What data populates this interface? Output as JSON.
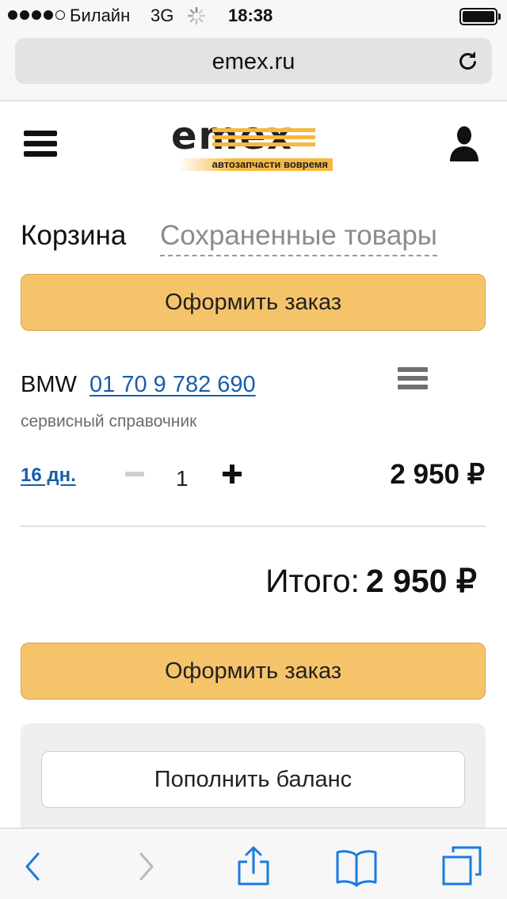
{
  "status_bar": {
    "carrier": "Билайн",
    "network": "3G",
    "time": "18:38",
    "signal_bars": 4,
    "signal_bars_total": 5
  },
  "address_bar": {
    "url": "emex.ru",
    "reload_icon": "reload-icon"
  },
  "header": {
    "menu_icon": "hamburger-menu-icon",
    "logo_text": "emex",
    "logo_tagline": "автозапчасти вовремя",
    "account_icon": "user-silhouette-icon"
  },
  "tabs": {
    "cart": "Корзина",
    "saved": "Сохраненные товары"
  },
  "order_button_label": "Оформить заказ",
  "cart_item": {
    "brand": "BMW",
    "article": "01 70 9 782 690",
    "description": "сервисный справочник",
    "delivery": "16 дн.",
    "quantity": "1",
    "price": "2 950 ₽",
    "menu_icon": "list-menu-icon"
  },
  "total": {
    "label": "Итого:",
    "value": "2 950 ₽"
  },
  "balance": {
    "button_label": "Пополнить баланс"
  },
  "toolbar": {
    "back_icon": "back-chevron-icon",
    "forward_icon": "forward-chevron-icon",
    "share_icon": "share-icon",
    "bookmarks_icon": "bookmarks-book-icon",
    "tabs_icon": "tabs-icon"
  },
  "colors": {
    "accent_button": "#f5c36a",
    "link": "#1a5ea8",
    "ios_blue": "#1a7ae0"
  }
}
